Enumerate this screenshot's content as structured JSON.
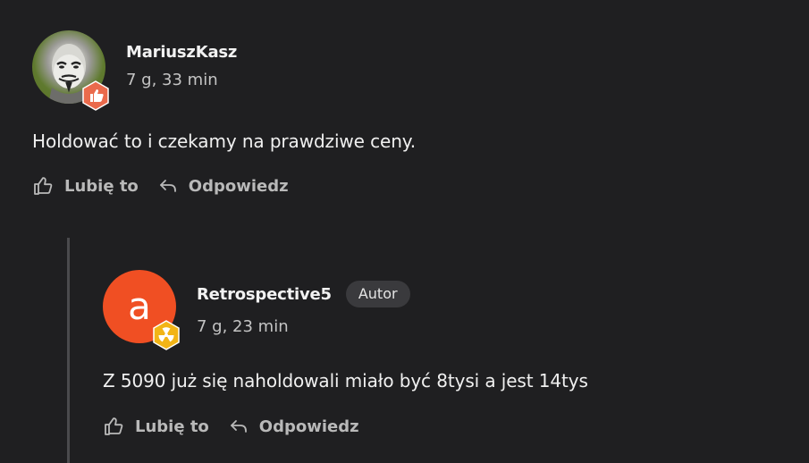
{
  "comment": {
    "username": "MariuszKasz",
    "time": "7 g, 33 min",
    "text": "Holdować to i czekamy na prawdziwe ceny.",
    "like_label": "Lubię to",
    "reply_label": "Odpowiedz",
    "avatar_icon": "anonymous-mask-avatar",
    "rank_icon": "thumbs-up-badge-icon",
    "rank_color": "#ea6a4c"
  },
  "reply": {
    "username": "Retrospective5",
    "author_badge": "Autor",
    "avatar_letter": "a",
    "avatar_color": "#f04f23",
    "time": "7 g, 23 min",
    "text": "Z 5090 już się naholdowali miało być 8tysi a jest 14tys",
    "like_label": "Lubię to",
    "reply_label": "Odpowiedz",
    "rank_icon": "radiation-badge-icon",
    "rank_color": "#f2b416"
  },
  "colors": {
    "background": "#1f1f21",
    "thread_line": "#4a4a4d",
    "action_text": "#b9b9b9"
  }
}
